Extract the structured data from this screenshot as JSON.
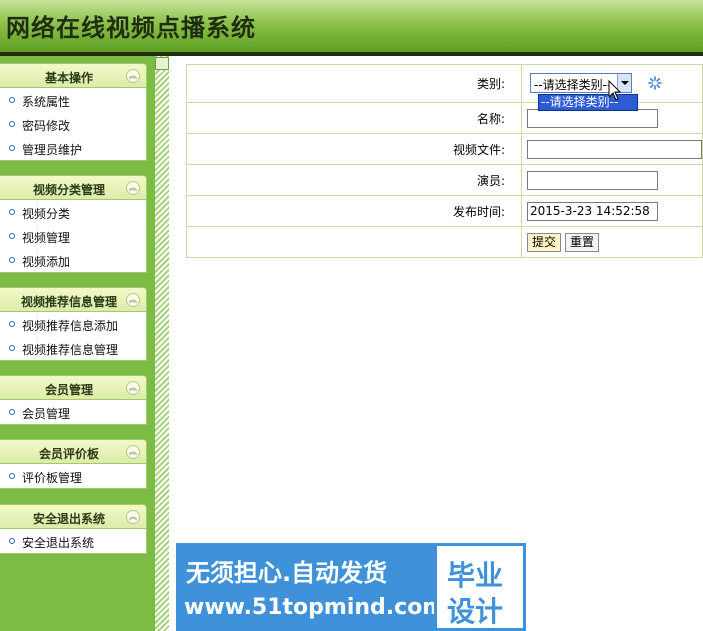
{
  "header": {
    "title": "网络在线视频点播系统"
  },
  "sidebar": {
    "groups": [
      {
        "title": "基本操作",
        "items": [
          "系统属性",
          "密码修改",
          "管理员维护"
        ]
      },
      {
        "title": "视频分类管理",
        "items": [
          "视频分类",
          "视频管理",
          "视频添加"
        ]
      },
      {
        "title": "视频推荐信息管理",
        "items": [
          "视频推荐信息添加",
          "视频推荐信息管理"
        ]
      },
      {
        "title": "会员管理",
        "items": [
          "会员管理"
        ]
      },
      {
        "title": "会员评价板",
        "items": [
          "评价板管理"
        ]
      },
      {
        "title": "安全退出系统",
        "items": [
          "安全退出系统"
        ]
      }
    ]
  },
  "form": {
    "category_label": "类别:",
    "category_value": "--请选择类别--",
    "category_options": [
      "--请选择类别--"
    ],
    "name_label": "名称:",
    "name_value": "",
    "video_file_label": "视频文件:",
    "video_file_value": "",
    "actor_label": "演员:",
    "actor_value": "",
    "publish_time_label": "发布时间:",
    "publish_time_value": "2015-3-23 14:52:58",
    "submit_label": "提交",
    "reset_label": "重置"
  },
  "watermark": {
    "line1": "无须担心.自动发货",
    "line2": "www.51topmind.com",
    "right1": "毕业",
    "right2": "设计"
  },
  "icons": {
    "collapse": "chevron-up-icon",
    "loading": "spinner-icon",
    "cursor": "mouse-cursor-icon"
  }
}
